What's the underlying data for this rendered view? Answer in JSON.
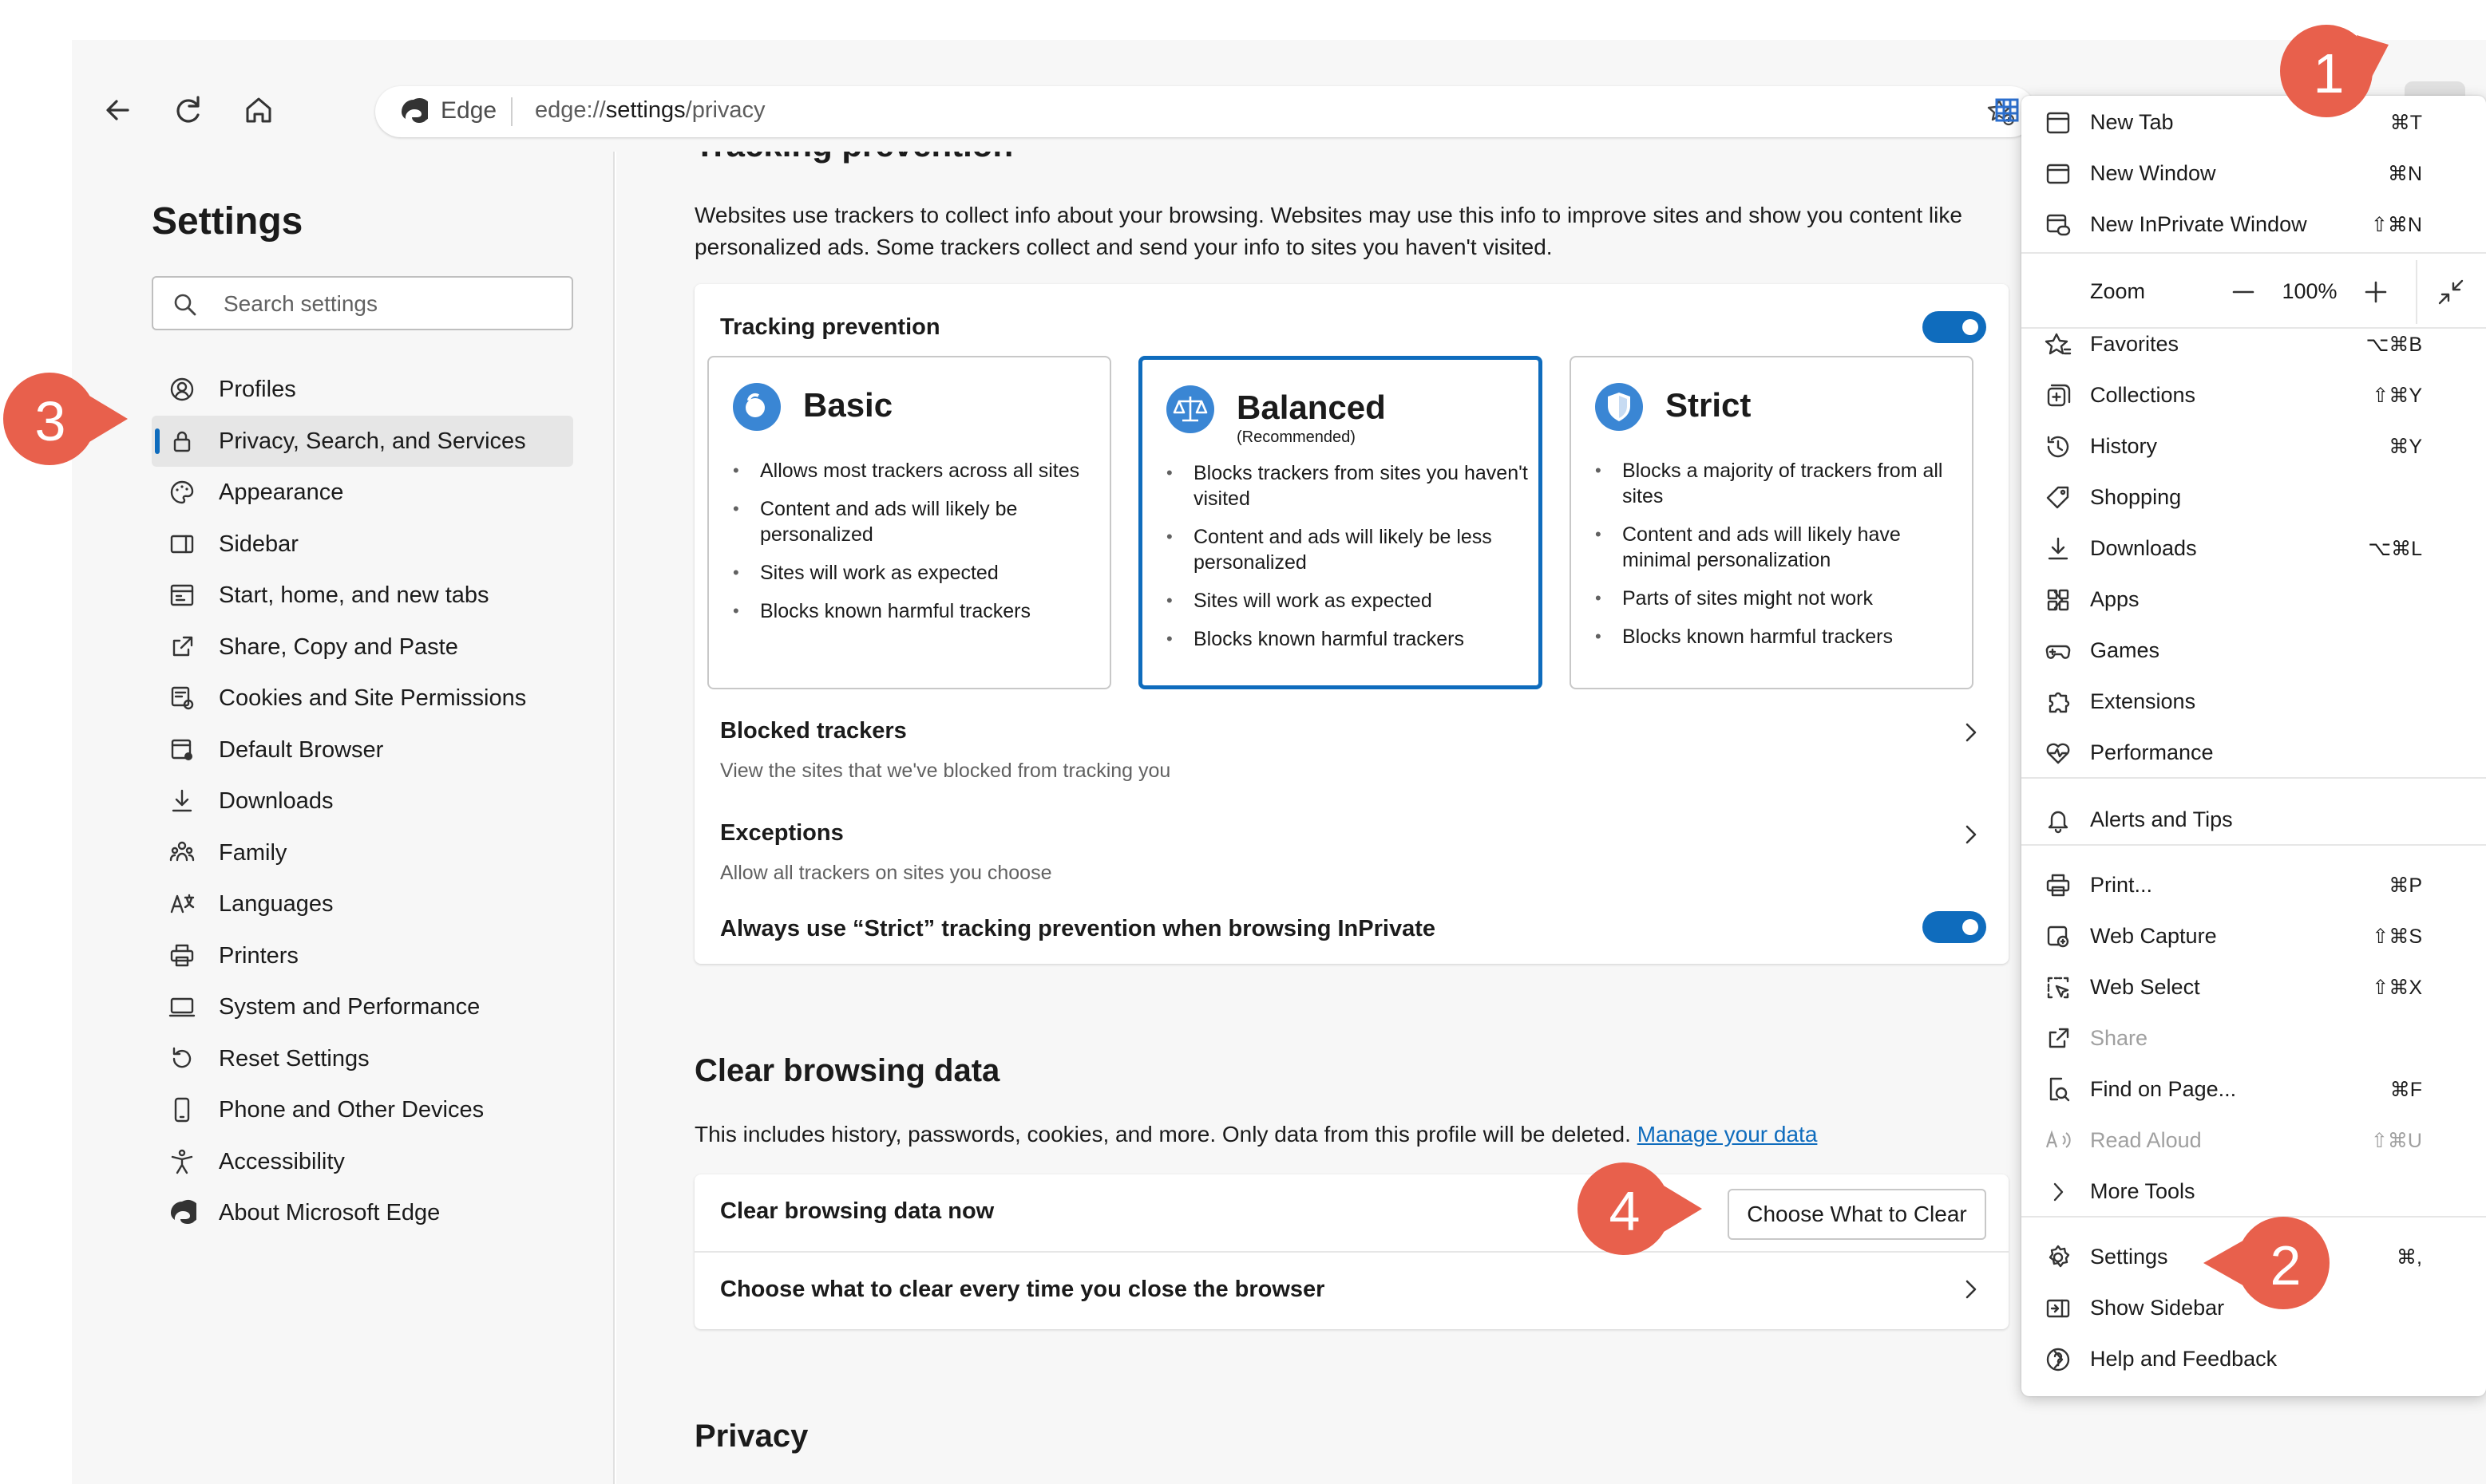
{
  "toolbar": {
    "address_brand": "Edge",
    "url_prefix": "edge://",
    "url_bold": "settings",
    "url_suffix": "/privacy",
    "more_label": "···"
  },
  "sidebar": {
    "title": "Settings",
    "search_placeholder": "Search settings",
    "items": [
      {
        "label": "Profiles",
        "icon": "profile-icon"
      },
      {
        "label": "Privacy, Search, and Services",
        "icon": "lock-icon",
        "active": true
      },
      {
        "label": "Appearance",
        "icon": "palette-icon"
      },
      {
        "label": "Sidebar",
        "icon": "sidebar-icon"
      },
      {
        "label": "Start, home, and new tabs",
        "icon": "home-tabs-icon"
      },
      {
        "label": "Share, Copy and Paste",
        "icon": "share-icon"
      },
      {
        "label": "Cookies and Site Permissions",
        "icon": "cookies-icon"
      },
      {
        "label": "Default Browser",
        "icon": "default-browser-icon"
      },
      {
        "label": "Downloads",
        "icon": "download-icon"
      },
      {
        "label": "Family",
        "icon": "family-icon"
      },
      {
        "label": "Languages",
        "icon": "languages-icon"
      },
      {
        "label": "Printers",
        "icon": "printer-icon"
      },
      {
        "label": "System and Performance",
        "icon": "system-icon"
      },
      {
        "label": "Reset Settings",
        "icon": "reset-icon"
      },
      {
        "label": "Phone and Other Devices",
        "icon": "phone-icon"
      },
      {
        "label": "Accessibility",
        "icon": "accessibility-icon"
      },
      {
        "label": "About Microsoft Edge",
        "icon": "edge-logo-icon"
      }
    ]
  },
  "tracking": {
    "heading": "Tracking prevention",
    "description": "Websites use trackers to collect info about your browsing. Websites may use this info to improve sites and show you content like personalized ads. Some trackers collect and send your info to sites you haven't visited.",
    "card_title": "Tracking prevention",
    "toggle_on": true,
    "levels": [
      {
        "name": "Basic",
        "recommended": "",
        "selected": false,
        "bullets": [
          "Allows most trackers across all sites",
          "Content and ads will likely be personalized",
          "Sites will work as expected",
          "Blocks known harmful trackers"
        ]
      },
      {
        "name": "Balanced",
        "recommended": "(Recommended)",
        "selected": true,
        "bullets": [
          "Blocks trackers from sites you haven't visited",
          "Content and ads will likely be less personalized",
          "Sites will work as expected",
          "Blocks known harmful trackers"
        ]
      },
      {
        "name": "Strict",
        "recommended": "",
        "selected": false,
        "bullets": [
          "Blocks a majority of trackers from all sites",
          "Content and ads will likely have minimal personalization",
          "Parts of sites might not work",
          "Blocks known harmful trackers"
        ]
      }
    ],
    "blocked_title": "Blocked trackers",
    "blocked_sub": "View the sites that we've blocked from tracking you",
    "exceptions_title": "Exceptions",
    "exceptions_sub": "Allow all trackers on sites you choose",
    "strict_inprivate": "Always use “Strict” tracking prevention when browsing InPrivate"
  },
  "clear": {
    "heading": "Clear browsing data",
    "description": "This includes history, passwords, cookies, and more. Only data from this profile will be deleted.",
    "manage_link": "Manage your data",
    "now_title": "Clear browsing data now",
    "button": "Choose What to Clear",
    "on_close": "Choose what to clear every time you close the browser"
  },
  "privacy": {
    "heading": "Privacy"
  },
  "menu": {
    "items": [
      {
        "label": "New Tab",
        "shortcut": "⌘T",
        "icon": "new-tab-icon"
      },
      {
        "label": "New Window",
        "shortcut": "⌘N",
        "icon": "new-window-icon"
      },
      {
        "label": "New InPrivate Window",
        "shortcut": "⇧⌘N",
        "icon": "inprivate-icon"
      },
      {
        "label": "Favorites",
        "shortcut": "⌥⌘B",
        "icon": "favorites-icon"
      },
      {
        "label": "Collections",
        "shortcut": "⇧⌘Y",
        "icon": "collections-icon"
      },
      {
        "label": "History",
        "shortcut": "⌘Y",
        "icon": "history-icon"
      },
      {
        "label": "Shopping",
        "shortcut": "",
        "icon": "shopping-tag-icon"
      },
      {
        "label": "Downloads",
        "shortcut": "⌥⌘L",
        "icon": "download-icon"
      },
      {
        "label": "Apps",
        "shortcut": "",
        "icon": "apps-icon",
        "submenu": true
      },
      {
        "label": "Games",
        "shortcut": "",
        "icon": "games-icon"
      },
      {
        "label": "Extensions",
        "shortcut": "",
        "icon": "extensions-icon"
      },
      {
        "label": "Performance",
        "shortcut": "",
        "icon": "performance-icon"
      },
      {
        "label": "Alerts and Tips",
        "shortcut": "",
        "icon": "bell-icon"
      },
      {
        "label": "Print...",
        "shortcut": "⌘P",
        "icon": "printer-icon"
      },
      {
        "label": "Web Capture",
        "shortcut": "⇧⌘S",
        "icon": "web-capture-icon"
      },
      {
        "label": "Web Select",
        "shortcut": "⇧⌘X",
        "icon": "web-select-icon"
      },
      {
        "label": "Share",
        "shortcut": "",
        "icon": "share-icon",
        "disabled": true
      },
      {
        "label": "Find on Page...",
        "shortcut": "⌘F",
        "icon": "find-icon"
      },
      {
        "label": "Read Aloud",
        "shortcut": "⇧⌘U",
        "icon": "read-aloud-icon",
        "disabled": true
      },
      {
        "label": "More Tools",
        "shortcut": "",
        "icon": "",
        "submenu": true
      },
      {
        "label": "Settings",
        "shortcut": "⌘,",
        "icon": "gear-icon"
      },
      {
        "label": "Show Sidebar",
        "shortcut": "",
        "icon": "show-sidebar-icon"
      },
      {
        "label": "Help and Feedback",
        "shortcut": "",
        "icon": "help-icon",
        "submenu": true
      }
    ],
    "zoom_label": "Zoom",
    "zoom_value": "100%"
  },
  "badges": [
    "1",
    "2",
    "3",
    "4"
  ],
  "colors": {
    "accent": "#0f6cbd",
    "badge": "#e8604c"
  }
}
